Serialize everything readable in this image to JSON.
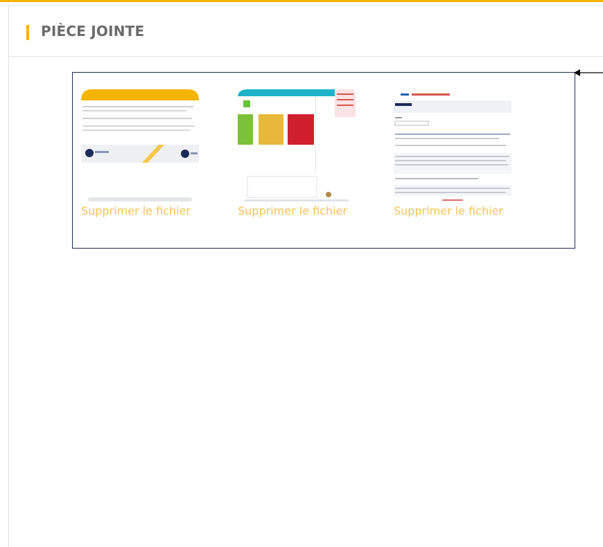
{
  "panel": {
    "title": "PIÈCE JOINTE"
  },
  "attachments": [
    {
      "delete_label": "Supprimer le fichier"
    },
    {
      "delete_label": "Supprimer le fichier"
    },
    {
      "delete_label": "Supprimer le fichier"
    }
  ],
  "colors": {
    "accent": "#f5b400",
    "link": "#f8c25a",
    "box_border": "#1c2a5a",
    "title": "#6b6b6b"
  }
}
